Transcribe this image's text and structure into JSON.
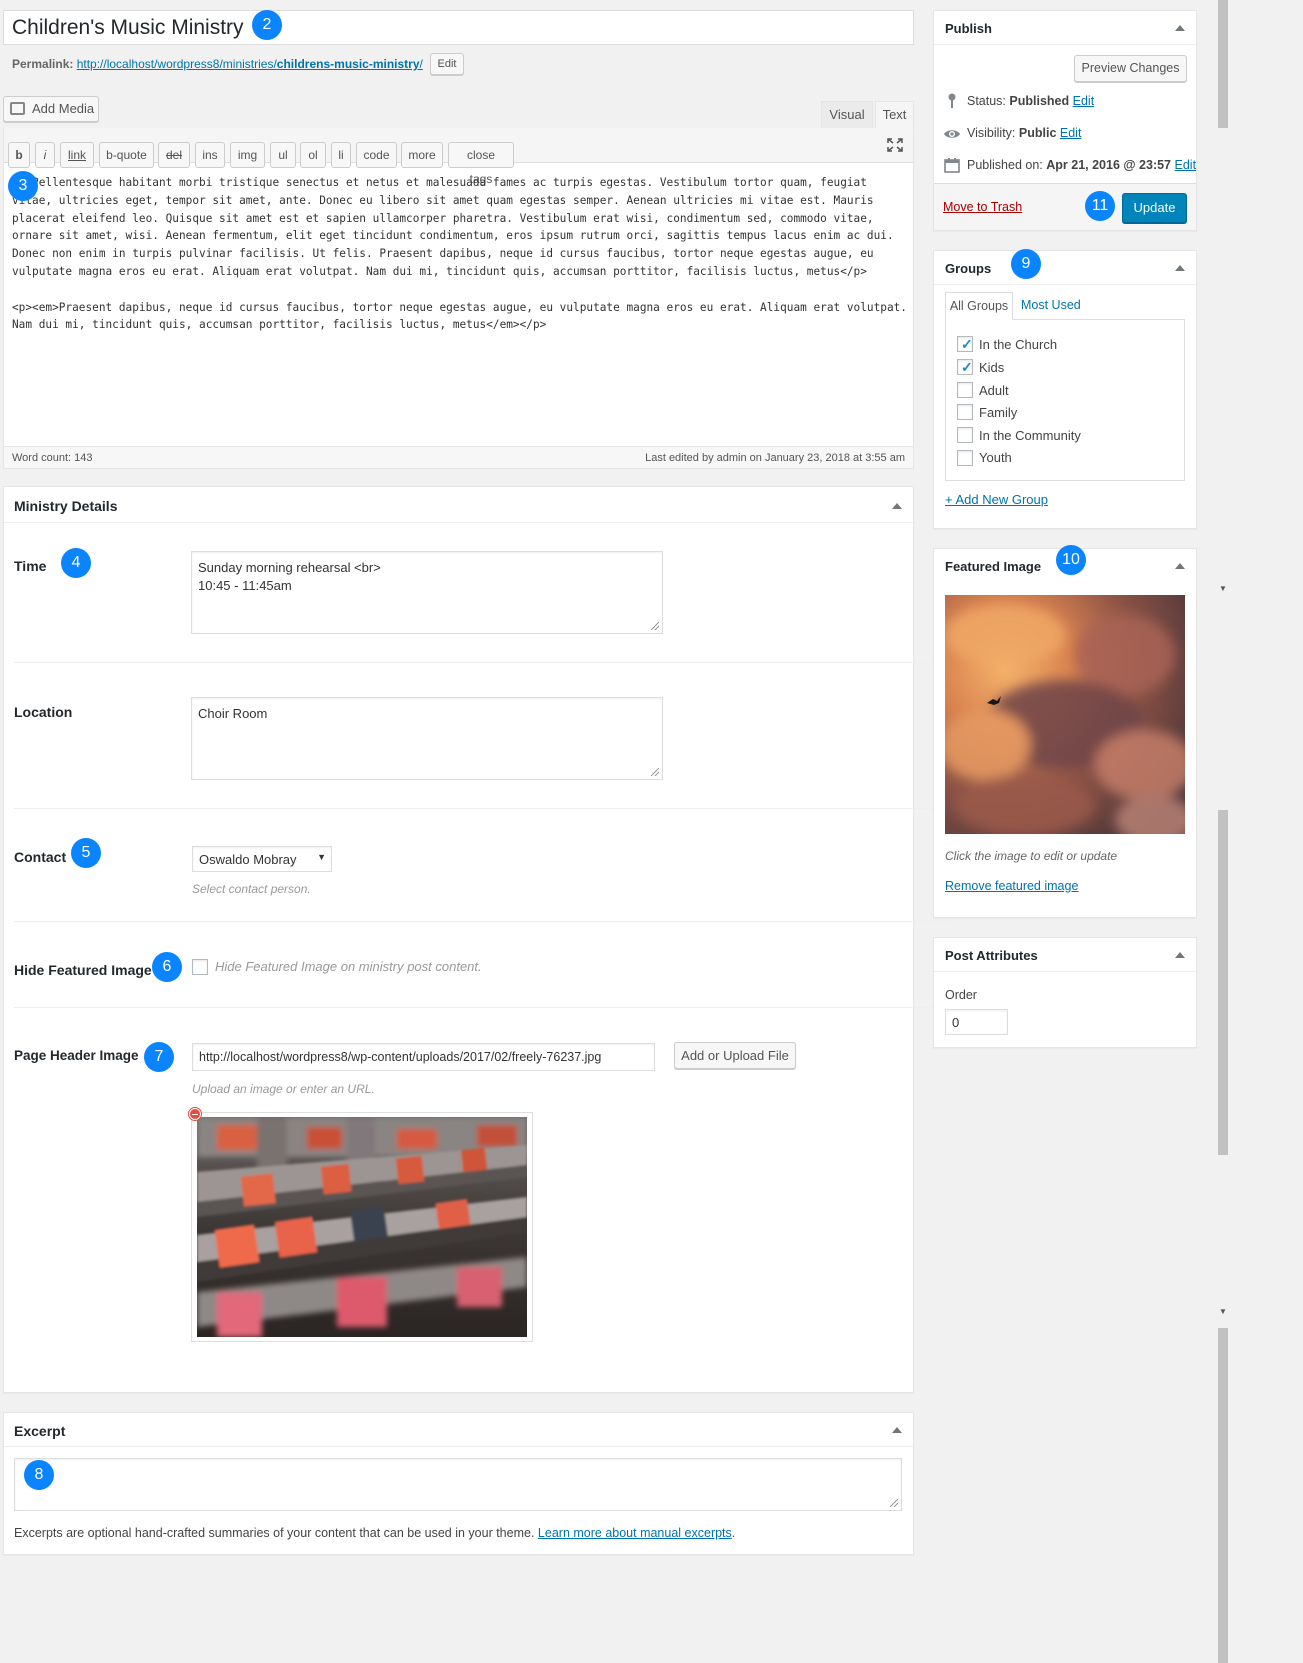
{
  "post": {
    "title": "Children's Music Ministry",
    "permalink_label": "Permalink:",
    "permalink_base": "http://localhost/wordpress8/ministries/",
    "permalink_slug": "childrens-music-ministry",
    "permalink_tail": "/",
    "permalink_edit": "Edit"
  },
  "editor": {
    "add_media": "Add Media",
    "tab_visual": "Visual",
    "tab_text": "Text",
    "quicktags": [
      "b",
      "i",
      "link",
      "b-quote",
      "del",
      "ins",
      "img",
      "ul",
      "ol",
      "li",
      "code",
      "more",
      "close tags"
    ],
    "content_p1": "<p>Pellentesque habitant morbi tristique senectus et netus et malesuada fames ac turpis egestas. Vestibulum tortor quam, feugiat vitae, ultricies eget, tempor sit amet, ante. Donec eu libero sit amet quam egestas semper. Aenean ultricies mi vitae est. Mauris placerat eleifend leo. Quisque sit amet est et sapien ullamcorper pharetra. Vestibulum erat wisi, condimentum sed, commodo vitae, ornare sit amet, wisi. Aenean fermentum, elit eget tincidunt condimentum, eros ipsum rutrum orci, sagittis tempus lacus enim ac dui. Donec non enim in turpis pulvinar facilisis. Ut felis. Praesent dapibus, neque id cursus faucibus, tortor neque egestas augue, eu vulputate magna eros eu erat. Aliquam erat volutpat. Nam dui mi, tincidunt quis, accumsan porttitor, facilisis luctus, metus</p>",
    "content_p2": "<p><em>Praesent dapibus, neque id cursus faucibus, tortor neque egestas augue, eu vulputate magna eros eu erat. Aliquam erat volutpat. Nam dui mi, tincidunt quis, accumsan porttitor, facilisis luctus, metus</em></p>",
    "word_count": "Word count: 143",
    "last_edited": "Last edited by admin on January 23, 2018 at 3:55 am"
  },
  "ministry_details": {
    "title": "Ministry Details",
    "time_label": "Time",
    "time_line1": "Sunday morning rehearsal <br>",
    "time_line2": "10:45 - 11:45am",
    "location_label": "Location",
    "location_value": "Choir Room",
    "contact_label": "Contact",
    "contact_value": "Oswaldo Mobray",
    "contact_hint": "Select contact person.",
    "hide_label": "Hide Featured Image",
    "hide_hint": "Hide Featured Image on ministry post content.",
    "header_label": "Page Header Image",
    "header_url": "http://localhost/wordpress8/wp-content/uploads/2017/02/freely-76237.jpg",
    "upload_button": "Add or Upload File",
    "upload_hint": "Upload an image or enter an URL."
  },
  "excerpt": {
    "title": "Excerpt",
    "help_text": "Excerpts are optional hand-crafted summaries of your content that can be used in your theme.",
    "help_link": "Learn more about manual excerpts",
    "help_end": "."
  },
  "publish": {
    "title": "Publish",
    "preview": "Preview Changes",
    "status_label": "Status:",
    "status_value": "Published",
    "visibility_label": "Visibility:",
    "visibility_value": "Public",
    "published_label": "Published on:",
    "published_value": "Apr 21, 2016 @ 23:57",
    "edit": "Edit",
    "trash": "Move to Trash",
    "update": "Update"
  },
  "groups": {
    "title": "Groups",
    "tab_all": "All Groups",
    "tab_used": "Most Used",
    "items": [
      {
        "label": "In the Church",
        "checked": true
      },
      {
        "label": "Kids",
        "checked": true
      },
      {
        "label": "Adult",
        "checked": false
      },
      {
        "label": "Family",
        "checked": false
      },
      {
        "label": "In the Community",
        "checked": false
      },
      {
        "label": "Youth",
        "checked": false
      }
    ],
    "add_new": "+ Add New Group"
  },
  "featured_image": {
    "title": "Featured Image",
    "hint": "Click the image to edit or update",
    "remove": "Remove featured image"
  },
  "post_attributes": {
    "title": "Post Attributes",
    "order_label": "Order",
    "order_value": "0"
  },
  "callouts": [
    "2",
    "3",
    "4",
    "5",
    "6",
    "7",
    "8",
    "9",
    "10",
    "11"
  ],
  "colors": {
    "primary": "#0085ba",
    "link": "#0073aa",
    "trash": "#a00",
    "callout": "#0a84ff"
  }
}
